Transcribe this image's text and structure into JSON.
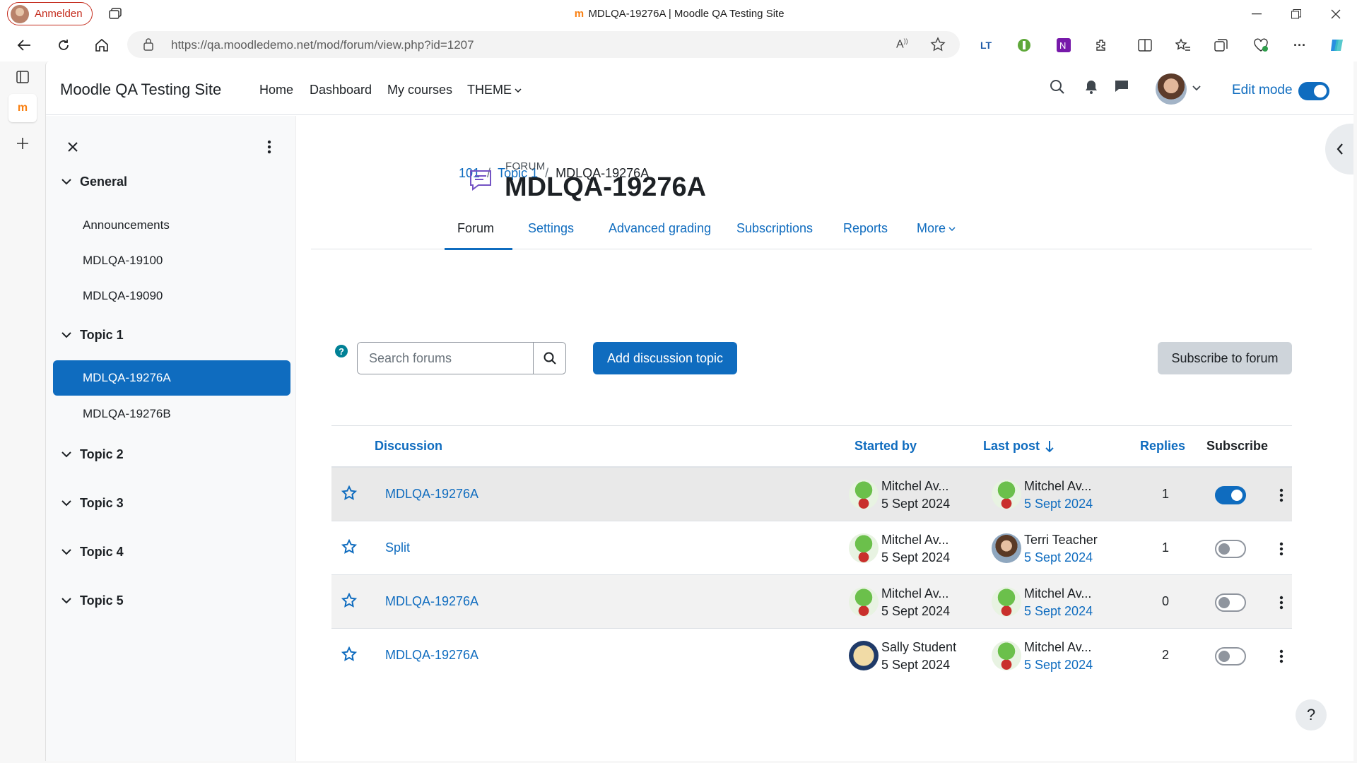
{
  "browser": {
    "profile_label": "Anmelden",
    "window_title": "MDLQA-19276A | Moodle QA Testing Site",
    "url": "https://qa.moodledemo.net/mod/forum/view.php?id=1207"
  },
  "site": {
    "name": "Moodle QA Testing Site",
    "nav": [
      "Home",
      "Dashboard",
      "My courses",
      "THEME"
    ],
    "edit_mode_label": "Edit mode"
  },
  "drawer": {
    "sections": [
      {
        "title": "General",
        "items": [
          "Announcements",
          "MDLQA-19100",
          "MDLQA-19090"
        ]
      },
      {
        "title": "Topic 1",
        "items": [
          "MDLQA-19276A",
          "MDLQA-19276B"
        ]
      },
      {
        "title": "Topic 2",
        "items": []
      },
      {
        "title": "Topic 3",
        "items": []
      },
      {
        "title": "Topic 4",
        "items": []
      },
      {
        "title": "Topic 5",
        "items": []
      }
    ]
  },
  "breadcrumb": [
    "101",
    "Topic 1",
    "MDLQA-19276A"
  ],
  "activity": {
    "type_label": "FORUM",
    "title": "MDLQA-19276A"
  },
  "secondary_nav": [
    "Forum",
    "Settings",
    "Advanced grading",
    "Subscriptions",
    "Reports",
    "More"
  ],
  "toolbar": {
    "search_placeholder": "Search forums",
    "add_topic_label": "Add discussion topic",
    "subscribe_label": "Subscribe to forum"
  },
  "table": {
    "headers": {
      "discussion": "Discussion",
      "started_by": "Started by",
      "last_post": "Last post",
      "replies": "Replies",
      "subscribe": "Subscribe"
    },
    "rows": [
      {
        "title": "MDLQA-19276A",
        "started_by": "Mitchel Av...",
        "started_date": "5 Sept 2024",
        "last_by": "Mitchel Av...",
        "last_date": "5 Sept 2024",
        "replies": "1",
        "subscribed": true
      },
      {
        "title": "Split",
        "started_by": "Mitchel Av...",
        "started_date": "5 Sept 2024",
        "last_by": "Terri Teacher",
        "last_date": "5 Sept 2024",
        "replies": "1",
        "subscribed": false
      },
      {
        "title": "MDLQA-19276A",
        "started_by": "Mitchel Av...",
        "started_date": "5 Sept 2024",
        "last_by": "Mitchel Av...",
        "last_date": "5 Sept 2024",
        "replies": "0",
        "subscribed": false
      },
      {
        "title": "MDLQA-19276A",
        "started_by": "Sally Student",
        "started_date": "5 Sept 2024",
        "last_by": "Mitchel Av...",
        "last_date": "5 Sept 2024",
        "replies": "2",
        "subscribed": false
      }
    ]
  },
  "help_label": "?",
  "colors": {
    "primary": "#0f6cbf",
    "profile": "#c42b1c"
  }
}
